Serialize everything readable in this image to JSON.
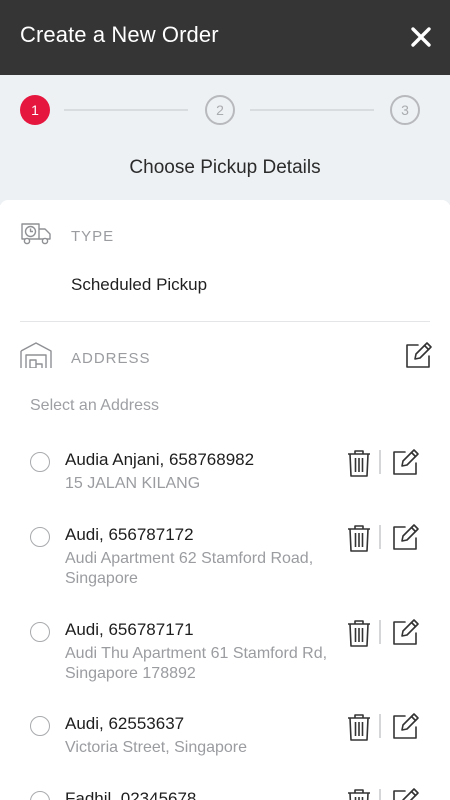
{
  "header": {
    "title": "Create a New Order",
    "close_icon": "close-icon"
  },
  "stepper": {
    "steps": [
      {
        "label": "1",
        "state": "active"
      },
      {
        "label": "2",
        "state": "inactive"
      },
      {
        "label": "3",
        "state": "inactive"
      }
    ],
    "title": "Choose Pickup Details"
  },
  "type_section": {
    "icon": "truck-clock-icon",
    "label": "TYPE",
    "value": "Scheduled Pickup"
  },
  "address_section": {
    "icon": "warehouse-icon",
    "label": "ADDRESS",
    "edit_icon": "edit-icon",
    "select_label": "Select an Address",
    "addresses": [
      {
        "name": "Audia Anjani, 658768982",
        "line": "15 JALAN KILANG"
      },
      {
        "name": "Audi, 656787172",
        "line": "Audi Apartment 62 Stamford Road, Singapore"
      },
      {
        "name": "Audi, 656787171",
        "line": "Audi Thu Apartment 61 Stamford Rd, Singapore 178892"
      },
      {
        "name": "Audi, 62553637",
        "line": "Victoria Street, Singapore"
      },
      {
        "name": "Fadhil, 02345678",
        "line": ""
      }
    ]
  },
  "colors": {
    "header_bg": "#353535",
    "accent": "#e5173f",
    "stepper_bg": "#eef1f4",
    "muted_text": "#9a9ca0"
  }
}
